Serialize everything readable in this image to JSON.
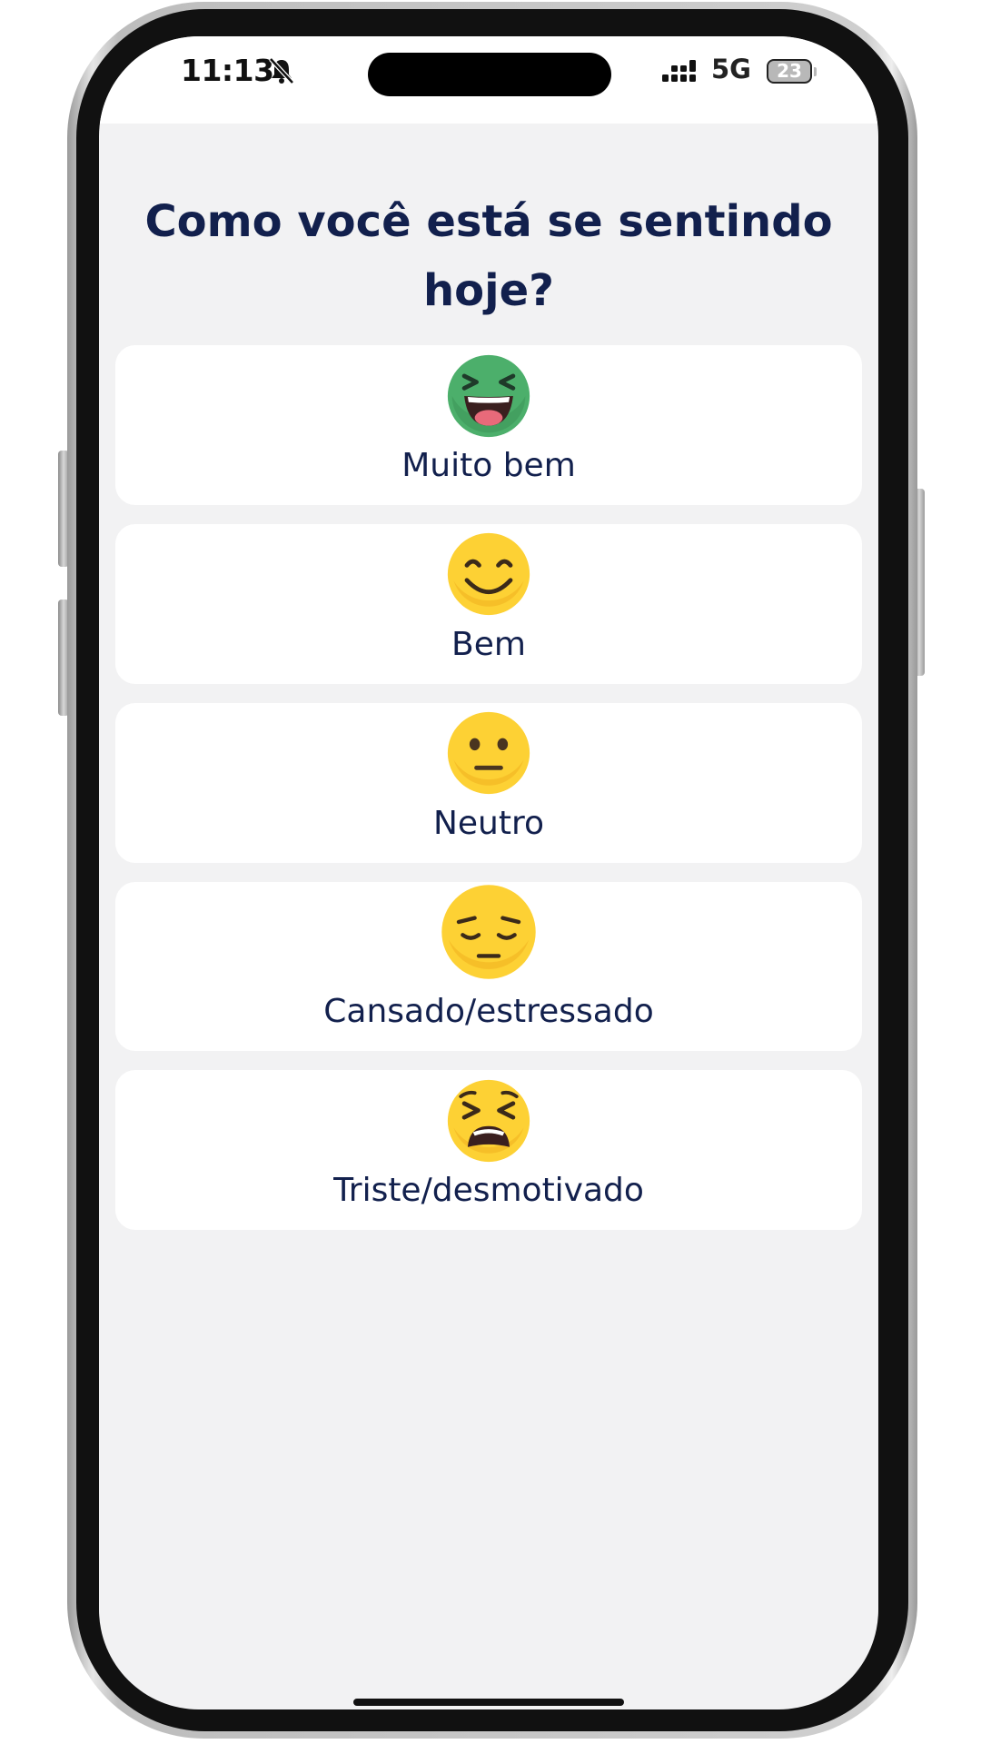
{
  "status_bar": {
    "time": "11:13",
    "network": "5G",
    "battery": "23"
  },
  "question": "Como você está se sentindo hoje?",
  "options": [
    {
      "label": "Muito bem",
      "emoji": "grinning-squinting-face-icon",
      "color": "#4caf6b"
    },
    {
      "label": "Bem",
      "emoji": "smiling-face-icon",
      "color": "#fdd134"
    },
    {
      "label": "Neutro",
      "emoji": "neutral-face-icon",
      "color": "#fdd134"
    },
    {
      "label": "Cansado/estressado",
      "emoji": "pensive-face-icon",
      "color": "#fdd134"
    },
    {
      "label": "Triste/desmotivado",
      "emoji": "tired-face-icon",
      "color": "#fdd134"
    }
  ],
  "colors": {
    "text": "#12204d",
    "background": "#f2f2f3",
    "card": "#ffffff"
  }
}
